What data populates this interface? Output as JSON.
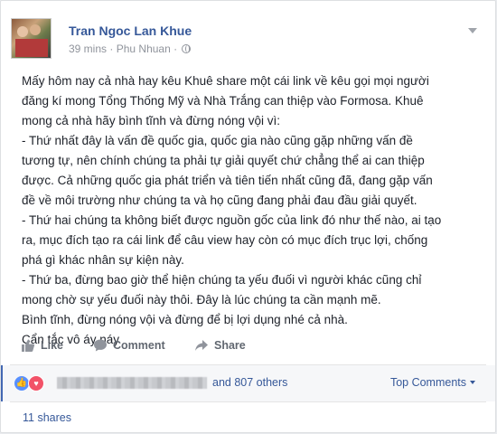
{
  "post": {
    "author": "Tran Ngoc Lan Khue",
    "time": "39 mins",
    "dot": "·",
    "location": "Phu Nhuan",
    "lines": [
      "Mấy hôm nay cả nhà hay kêu Khuê share một cái link về kêu gọi mọi người",
      "đăng kí mong Tổng Thống Mỹ và Nhà Trắng can thiệp vào Formosa. Khuê",
      "mong cả nhà hãy bình tĩnh và đừng nóng vội vì:",
      "- Thứ nhất đây là vấn đề quốc gia, quốc gia nào cũng gặp những vấn đề",
      "tương tự, nên chính chúng ta phải tự giải quyết chứ chẳng thể ai can thiệp",
      "được. Cả những quốc gia phát triển và tiên tiến nhất cũng đã, đang gặp vấn",
      "đề về môi trường như chúng ta và họ cũng đang phải đau đầu giải quyết.",
      "- Thứ hai chúng ta không biết được nguồn gốc của link đó như thế nào, ai tạo",
      "ra, mục đích tạo ra cái link để câu view hay còn có mục đích trục lợi, chống",
      "phá gì khác nhân sự kiện này.",
      "- Thứ ba, đừng bao giờ thể hiện chúng ta yếu đuối vì người khác cũng chỉ",
      "mong chờ sự yếu đuối này thôi. Đây là lúc chúng ta cần mạnh mẽ.",
      "Bình tĩnh, đừng nóng vội và đừng để bị lợi dụng nhé cả nhà.",
      "Cẩn tắc vô áy náy"
    ]
  },
  "actions": {
    "like": "Like",
    "comment": "Comment",
    "share": "Share"
  },
  "reactions": {
    "others": "and 807 others",
    "top_comments": "Top Comments"
  },
  "shares": "11 shares",
  "colors": {
    "link": "#365899",
    "text": "#1d2129",
    "muted": "#90949c",
    "like_blue": "#5890ff",
    "love_red": "#f25268"
  }
}
